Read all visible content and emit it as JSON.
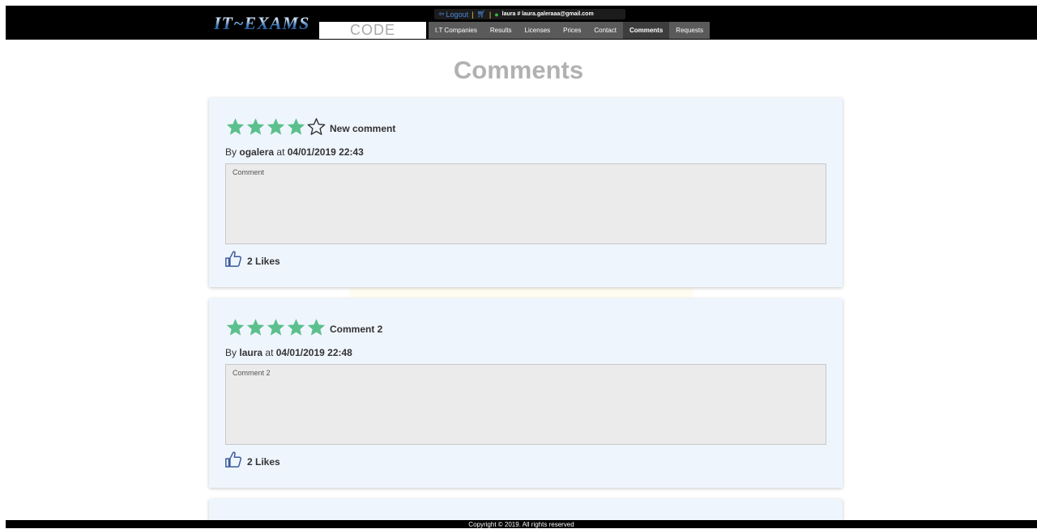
{
  "header": {
    "logo": "IT~EXAMS",
    "code_label": "CODE",
    "userbar": {
      "logout_label": "Logout",
      "user_label": "laura # laura.galeraaa@gmail.com"
    },
    "nav": [
      {
        "label": "I.T Companies",
        "active": false
      },
      {
        "label": "Results",
        "active": false
      },
      {
        "label": "Licenses",
        "active": false
      },
      {
        "label": "Prices",
        "active": false
      },
      {
        "label": "Contact",
        "active": false
      },
      {
        "label": "Comments",
        "active": true
      },
      {
        "label": "Requests",
        "active": false
      }
    ]
  },
  "page": {
    "title": "Comments"
  },
  "comments": [
    {
      "title": "New comment",
      "by_prefix": "By",
      "author": "ogalera",
      "at_word": "at",
      "timestamp": "04/01/2019 22:43",
      "rating": 4,
      "max_rating": 5,
      "body": "Comment",
      "likes_label": "2 Likes"
    },
    {
      "title": "Comment 2",
      "by_prefix": "By",
      "author": "laura",
      "at_word": "at",
      "timestamp": "04/01/2019 22:48",
      "rating": 5,
      "max_rating": 5,
      "body": "Comment 2",
      "likes_label": "2 Likes"
    }
  ],
  "footer": {
    "copyright": "Copyright © 2019. All rights reserved"
  },
  "colors": {
    "star_filled": "#5bc08d",
    "star_empty_stroke": "#333333",
    "card_bg": "#eff5fd",
    "nav_bg": "#5a5a5a",
    "title_gray": "#b1b1b1",
    "like_icon": "#3b5a9a"
  }
}
